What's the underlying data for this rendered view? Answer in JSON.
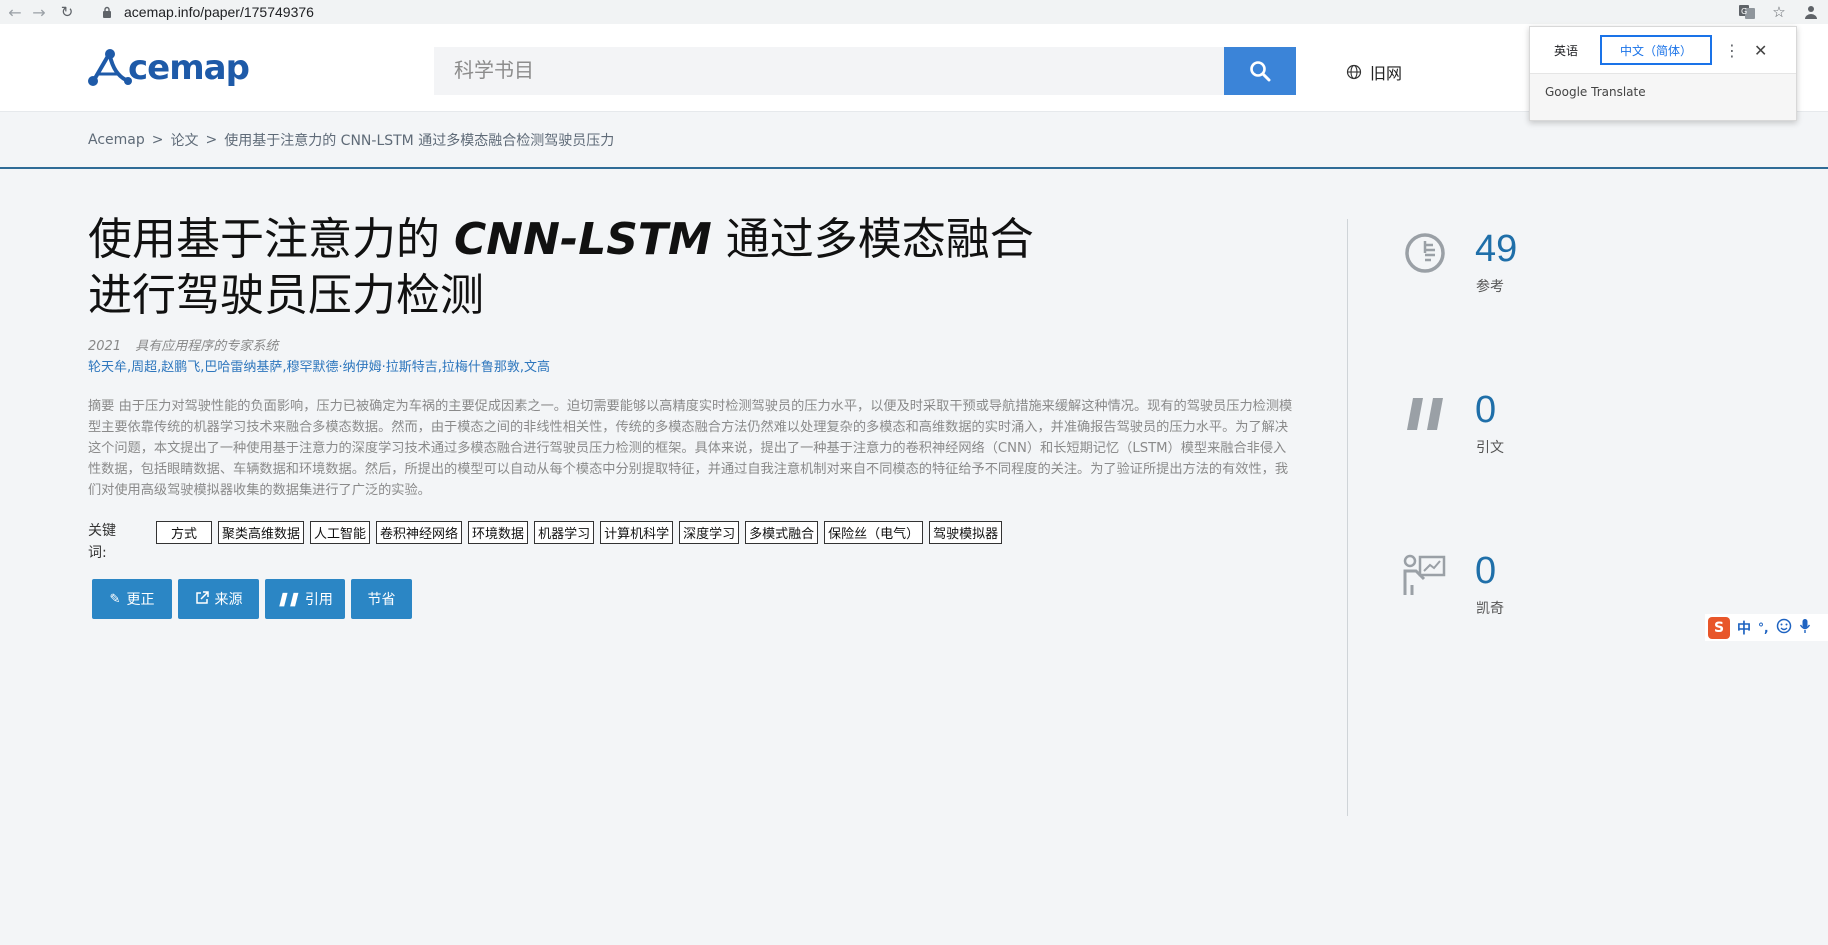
{
  "browser": {
    "url": "acemap.info/paper/175749376"
  },
  "header": {
    "logo_text": "cemap",
    "search_placeholder": "科学书目",
    "old_site_label": "旧网"
  },
  "translate_popup": {
    "lang_source": "英语",
    "lang_target": "中文（简体）",
    "brand": "Google Translate"
  },
  "breadcrumb": {
    "home": "Acemap",
    "section": "论文",
    "current": "使用基于注意力的 CNN-LSTM 通过多模态融合检测驾驶员压力"
  },
  "paper": {
    "title_part1": "使用基于注意力的 ",
    "title_bold": "CNN-LSTM",
    "title_part2": " 通过多模态融合进行驾驶员压力检测",
    "year": "2021",
    "venue": "具有应用程序的专家系统",
    "authors": "轮天牟,周超,赵鹏飞,巴哈雷纳基萨,穆罕默德·纳伊姆·拉斯特吉,拉梅什鲁那敦,文高",
    "abstract": "摘要 由于压力对驾驶性能的负面影响，压力已被确定为车祸的主要促成因素之一。迫切需要能够以高精度实时检测驾驶员的压力水平，以便及时采取干预或导航措施来缓解这种情况。现有的驾驶员压力检测模型主要依靠传统的机器学习技术来融合多模态数据。然而，由于模态之间的非线性相关性，传统的多模态融合方法仍然难以处理复杂的多模态和高维数据的实时涌入，并准确报告驾驶员的压力水平。为了解决这个问题，本文提出了一种使用基于注意力的深度学习技术通过多模态融合进行驾驶员压力检测的框架。具体来说，提出了一种基于注意力的卷积神经网络（CNN）和长短期记忆（LSTM）模型来融合非侵入性数据，包括眼睛数据、车辆数据和环境数据。然后，所提出的模型可以自动从每个模态中分别提取特征，并通过自我注意机制对来自不同模态的特征给予不同程度的关注。为了验证所提出方法的有效性，我们对使用高级驾驶模拟器收集的数据集进行了广泛的实验。",
    "keywords_label": "关键词:",
    "keywords": [
      "方式",
      "聚类高维数据",
      "人工智能",
      "卷积神经网络",
      "环境数据",
      "机器学习",
      "计算机科学",
      "深度学习",
      "多模式融合",
      "保险丝（电气）",
      "驾驶模拟器"
    ]
  },
  "actions": {
    "correct": "更正",
    "source": "来源",
    "cite": "引用",
    "save": "节省"
  },
  "stats": {
    "references_count": "49",
    "references_label": "参考",
    "citations_count": "0",
    "citations_label": "引文",
    "kaiqi_count": "0",
    "kaiqi_label": "凯奇"
  },
  "ime": {
    "mode": "中",
    "punct": "°,"
  },
  "colors": {
    "accent": "#2b86c5",
    "search_button": "#3b84d8",
    "link": "#2d76bd",
    "stat_number": "#1f6fa9"
  }
}
